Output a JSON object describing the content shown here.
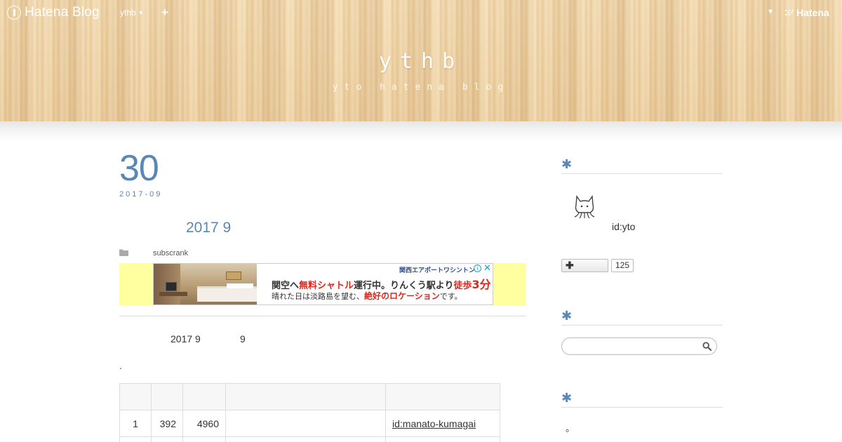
{
  "topbar": {
    "logo_text": "Hatena Blog",
    "blog_selector": "ythb",
    "add_label": "+",
    "brand": "Hatena"
  },
  "header": {
    "title": "ythb",
    "description": "yto hatena blog"
  },
  "entry": {
    "date_day": "30",
    "date_year_month": "2017-09",
    "title": "2017 9",
    "category": "subscrank",
    "body_text_1": "2017 9",
    "body_text_2": "9",
    "body_dot": "."
  },
  "ad": {
    "brand": "関西エアポートワシントン",
    "info": "i",
    "close": "✕",
    "line1_a": "関空へ",
    "line1_b": "無料シャトル",
    "line1_c": "運行中。りんくう駅より",
    "line1_d": "徒歩",
    "line1_e": "3分",
    "line2_a": "晴れた日は淡路島を望む、",
    "line2_b": "絶好のロケーション",
    "line2_c": "です。"
  },
  "table": {
    "headers": [
      "",
      "",
      "",
      "",
      ""
    ],
    "rows": [
      {
        "rank": "1",
        "col2": "392",
        "col3": "4960",
        "col4": "",
        "user": "id:manato-kumagai"
      }
    ]
  },
  "sidebar": {
    "profile_heading": "✱",
    "profile_id": "id:yto",
    "subscribe_label": "✚",
    "subscribe_count": "125",
    "search_heading": "✱",
    "search_placeholder": "",
    "third_heading": "✱",
    "third_text": "。"
  },
  "colors": {
    "accent": "#5a87b5",
    "ad_background": "#ffffa0",
    "ad_red": "#e2231a"
  }
}
